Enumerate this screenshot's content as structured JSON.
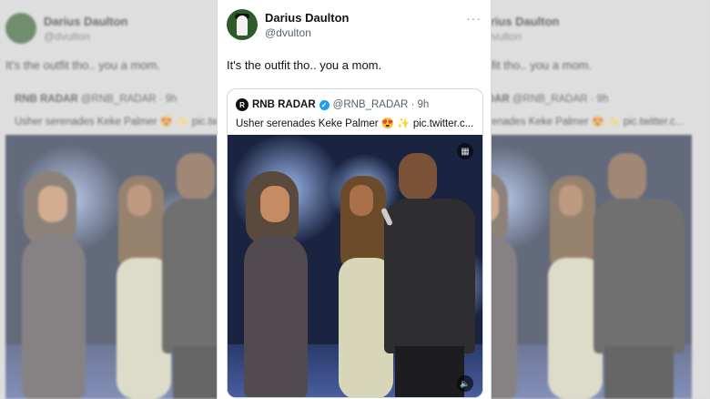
{
  "tweet": {
    "author_name": "Darius Daulton",
    "author_handle": "@dvulton",
    "more_label": "···",
    "text": "It's the outfit tho.. you a mom."
  },
  "quoted": {
    "logo_text": "R",
    "author_name": "RNB RADAR",
    "verified_mark": "✓",
    "meta": "@RNB_RADAR · 9h",
    "text": "Usher serenades Keke Palmer 😍 ✨ pic.twitter.c..."
  },
  "video": {
    "top_icon": "video-gallery-icon",
    "top_glyph": "▦",
    "bottom_icon": "speaker-icon",
    "bottom_glyph": "🔈"
  },
  "colors": {
    "verified": "#1d9bf0",
    "avatar_bg": "#2e5b2a",
    "text_primary": "#0f1419",
    "text_secondary": "#536471"
  }
}
